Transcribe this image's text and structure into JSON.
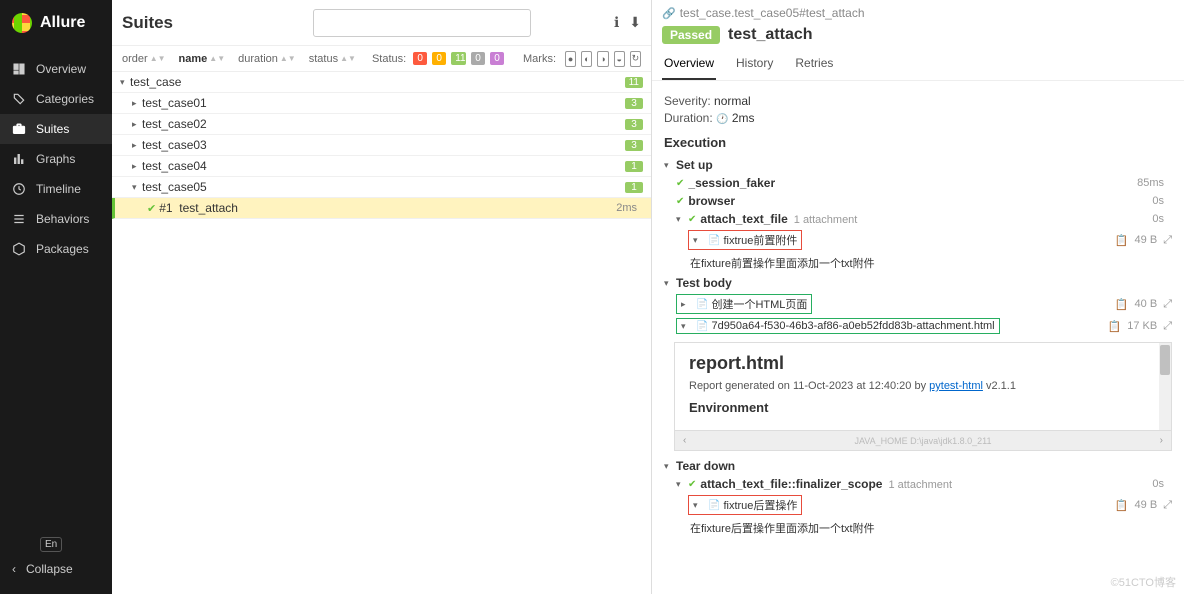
{
  "brand": "Allure",
  "nav": {
    "overview": "Overview",
    "categories": "Categories",
    "suites": "Suites",
    "graphs": "Graphs",
    "timeline": "Timeline",
    "behaviors": "Behaviors",
    "packages": "Packages"
  },
  "lang": "En",
  "collapse": "Collapse",
  "middle": {
    "title": "Suites",
    "search_placeholder": "",
    "cols": {
      "order": "order",
      "name": "name",
      "duration": "duration",
      "status": "status"
    },
    "status_label": "Status:",
    "status_counts": {
      "failed": "0",
      "broken": "0",
      "passed": "11",
      "skipped": "0",
      "unknown": "0"
    },
    "marks_label": "Marks:"
  },
  "tree": {
    "root": "test_case",
    "root_count": "11",
    "items": [
      {
        "name": "test_case01",
        "count": "3"
      },
      {
        "name": "test_case02",
        "count": "3"
      },
      {
        "name": "test_case03",
        "count": "3"
      },
      {
        "name": "test_case04",
        "count": "1"
      },
      {
        "name": "test_case05",
        "count": "1"
      }
    ],
    "leaf": {
      "num": "#1",
      "name": "test_attach",
      "duration": "2ms"
    }
  },
  "detail": {
    "breadcrumb": "test_case.test_case05#test_attach",
    "status": "Passed",
    "title": "test_attach",
    "tabs": {
      "overview": "Overview",
      "history": "History",
      "retries": "Retries"
    },
    "severity_label": "Severity:",
    "severity": "normal",
    "duration_label": "Duration:",
    "duration": "2ms",
    "execution": "Execution",
    "setup": {
      "label": "Set up",
      "items": [
        {
          "name": "_session_faker",
          "time": "85ms"
        },
        {
          "name": "browser",
          "time": "0s"
        }
      ],
      "attach": {
        "name": "attach_text_file",
        "count": "1 attachment",
        "time": "0s",
        "file": "fixtrue前置附件",
        "size": "49 B",
        "desc": "在fixture前置操作里面添加一个txt附件"
      }
    },
    "body": {
      "label": "Test body",
      "step1": {
        "name": "创建一个HTML页面",
        "size": "40 B"
      },
      "step2": {
        "name": "7d950a64-f530-46b3-af86-a0eb52fdd83b-attachment.html",
        "size": "17 KB"
      }
    },
    "preview": {
      "title": "report.html",
      "sub_prefix": "Report generated on 11-Oct-2023 at 12:40:20 by ",
      "sub_link": "pytest-html",
      "sub_suffix": " v2.1.1",
      "env": "Environment",
      "env_row": "JAVA_HOME   D:\\java\\jdk1.8.0_211"
    },
    "teardown": {
      "label": "Tear down",
      "attach": {
        "name": "attach_text_file::finalizer_scope",
        "count": "1 attachment",
        "time": "0s",
        "file": "fixtrue后置操作",
        "size": "49 B",
        "desc": "在fixture后置操作里面添加一个txt附件"
      }
    }
  },
  "watermark": "©51CTO博客"
}
